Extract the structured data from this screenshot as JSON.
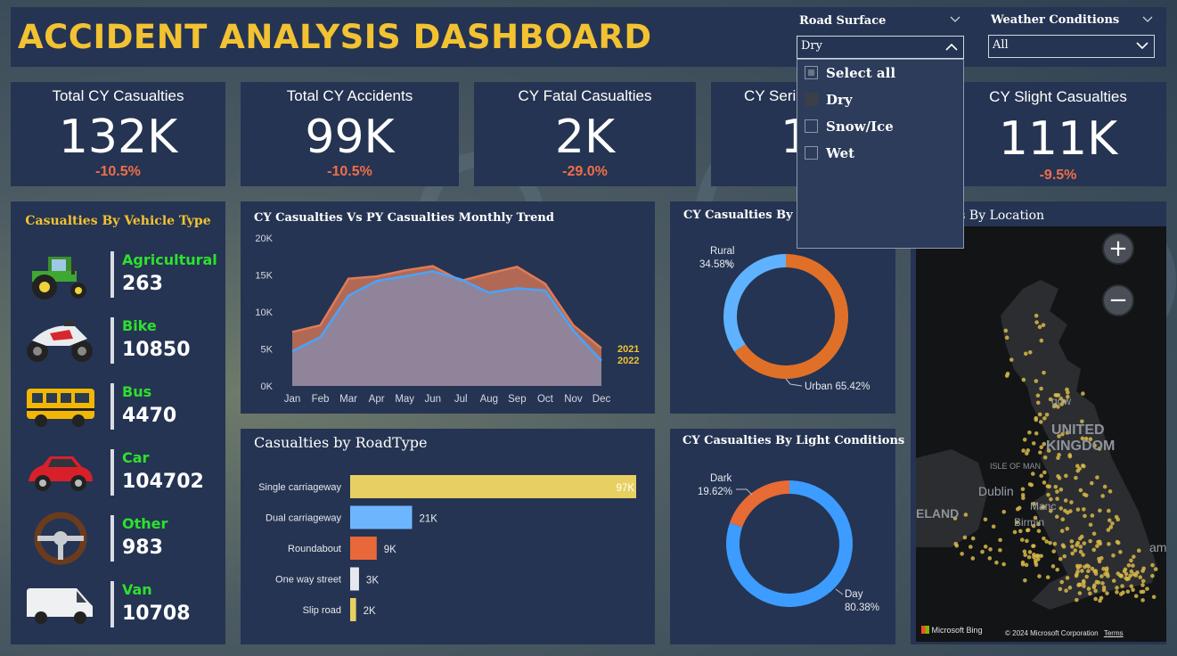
{
  "header": {
    "title": "ACCIDENT ANALYSIS DASHBOARD"
  },
  "filters": {
    "road_surface": {
      "label": "Road Surface",
      "selected": "Dry",
      "options": [
        {
          "label": "Select all",
          "state": "partial"
        },
        {
          "label": "Dry",
          "state": "checked"
        },
        {
          "label": "Snow/Ice",
          "state": "unchecked"
        },
        {
          "label": "Wet",
          "state": "unchecked"
        }
      ]
    },
    "weather": {
      "label": "Weather Conditions",
      "selected": "All"
    }
  },
  "kpis": [
    {
      "label": "Total CY Casualties",
      "value": "132K",
      "delta": "-10.5%"
    },
    {
      "label": "Total CY Accidents",
      "value": "99K",
      "delta": "-10.5%"
    },
    {
      "label": "CY Fatal Casualties",
      "value": "2K",
      "delta": "-29.0%"
    },
    {
      "label": "CY Seri",
      "value": "1",
      "delta": ""
    },
    {
      "label": "CY Slight Casualties",
      "value": "111K",
      "delta": "-9.5%"
    }
  ],
  "vehicles": {
    "title": "Casualties By Vehicle Type",
    "items": [
      {
        "name": "Agricultural",
        "value": "263",
        "icon": "tractor-icon"
      },
      {
        "name": "Bike",
        "value": "10850",
        "icon": "motorbike-icon"
      },
      {
        "name": "Bus",
        "value": "4470",
        "icon": "bus-icon"
      },
      {
        "name": "Car",
        "value": "104702",
        "icon": "car-icon"
      },
      {
        "name": "Other",
        "value": "983",
        "icon": "steering-wheel-icon"
      },
      {
        "name": "Van",
        "value": "10708",
        "icon": "van-icon"
      }
    ]
  },
  "colors": {
    "accent": "#f2c232",
    "green": "#2ee02e",
    "delta": "#f06e4a",
    "panel": "#253452",
    "py": "#e07b57",
    "cy": "#4aa3ff"
  },
  "map": {
    "title": "es By Location",
    "labels": [
      "UNITED",
      "KINGDOM",
      "ISLE OF MAN",
      "Dublin",
      "ELAND",
      "Manc",
      "Birmin",
      "gow",
      "ams"
    ],
    "attribution": "Microsoft Bing",
    "copyright": "© 2024 Microsoft Corporation",
    "terms": "Terms"
  },
  "chart_data": [
    {
      "type": "area",
      "title": "CY Casualties Vs PY Casualties Monthly Trend",
      "categories": [
        "Jan",
        "Feb",
        "Mar",
        "Apr",
        "May",
        "Jun",
        "Jul",
        "Aug",
        "Sep",
        "Oct",
        "Nov",
        "Dec"
      ],
      "yticks": [
        "0K",
        "5K",
        "10K",
        "15K",
        "20K"
      ],
      "ylim": [
        0,
        20000
      ],
      "series": [
        {
          "name": "2021",
          "values": [
            7300,
            8200,
            14500,
            14800,
            15600,
            16200,
            14200,
            15200,
            16100,
            13800,
            8200,
            5100
          ]
        },
        {
          "name": "2022",
          "values": [
            4700,
            6600,
            12200,
            14200,
            14800,
            15500,
            14400,
            12600,
            13200,
            12900,
            7500,
            3400
          ]
        }
      ]
    },
    {
      "type": "bar",
      "title": "Casualties by RoadType",
      "categories": [
        "Single carriageway",
        "Dual carriageway",
        "Roundabout",
        "One way street",
        "Slip road"
      ],
      "values": [
        97000,
        21000,
        9000,
        3000,
        2000
      ],
      "labels": [
        "97K",
        "21K",
        "9K",
        "3K",
        "2K"
      ],
      "colors": [
        "#e8cf62",
        "#6db6ff",
        "#e8683a",
        "#e6e8ee",
        "#e8cf62"
      ]
    },
    {
      "type": "pie",
      "title": "CY Casualties By Ur",
      "slices": [
        {
          "name": "Urban",
          "value": 65.42,
          "label": "65.42%",
          "color": "#e07028"
        },
        {
          "name": "Rural",
          "value": 34.58,
          "label": "34.58%",
          "color": "#5fb2ff"
        }
      ]
    },
    {
      "type": "pie",
      "title": "CY Casualties By Light Conditions",
      "slices": [
        {
          "name": "Day",
          "value": 80.38,
          "label": "80.38%",
          "color": "#3d9cff"
        },
        {
          "name": "Dark",
          "value": 19.62,
          "label": "19.62%",
          "color": "#e86a35"
        }
      ]
    }
  ]
}
